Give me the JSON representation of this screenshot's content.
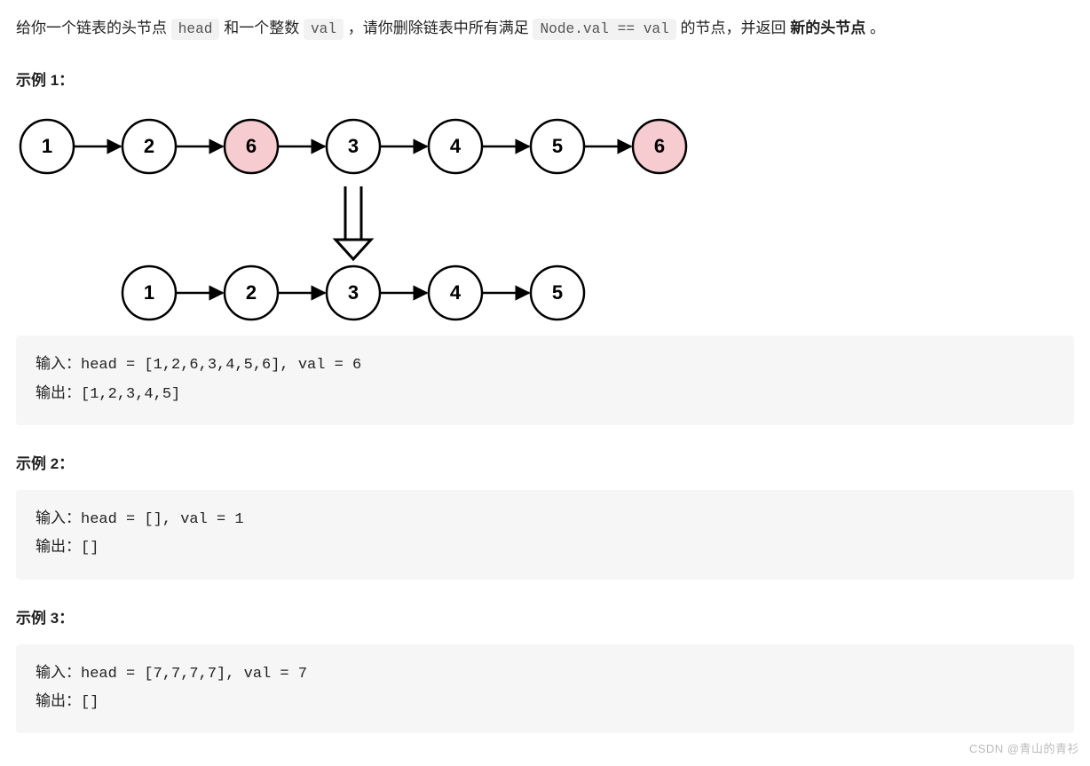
{
  "description": {
    "t1": "给你一个链表的头节点 ",
    "code1": "head",
    "t2": " 和一个整数 ",
    "code2": "val",
    "t3": " ，请你删除链表中所有满足 ",
    "code3": "Node.val == val",
    "t4": " 的节点，并返回 ",
    "bold": "新的头节点",
    "t5": " 。"
  },
  "diagram": {
    "before": [
      {
        "v": "1",
        "hl": false
      },
      {
        "v": "2",
        "hl": false
      },
      {
        "v": "6",
        "hl": true
      },
      {
        "v": "3",
        "hl": false
      },
      {
        "v": "4",
        "hl": false
      },
      {
        "v": "5",
        "hl": false
      },
      {
        "v": "6",
        "hl": true
      }
    ],
    "after": [
      {
        "v": "1"
      },
      {
        "v": "2"
      },
      {
        "v": "3"
      },
      {
        "v": "4"
      },
      {
        "v": "5"
      }
    ]
  },
  "examples": [
    {
      "title": "示例 1：",
      "inputLabel": "输入：",
      "inputValue": "head = [1,2,6,3,4,5,6], val = 6",
      "outputLabel": "输出：",
      "outputValue": "[1,2,3,4,5]"
    },
    {
      "title": "示例 2：",
      "inputLabel": "输入：",
      "inputValue": "head = [], val = 1",
      "outputLabel": "输出：",
      "outputValue": "[]"
    },
    {
      "title": "示例 3：",
      "inputLabel": "输入：",
      "inputValue": "head = [7,7,7,7], val = 7",
      "outputLabel": "输出：",
      "outputValue": "[]"
    }
  ],
  "watermark": "CSDN @青山的青衫"
}
